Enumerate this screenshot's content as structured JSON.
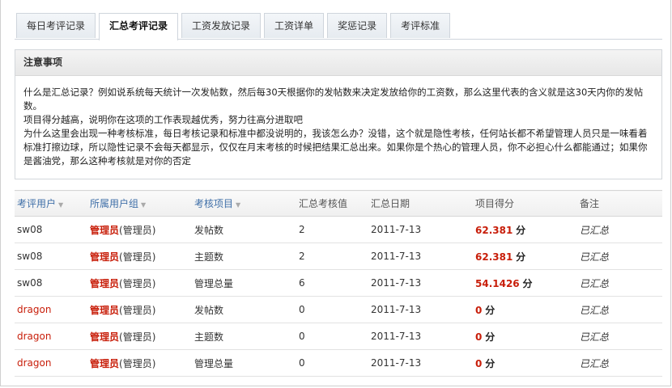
{
  "tabs": [
    {
      "label": "每日考评记录",
      "active": false
    },
    {
      "label": "汇总考评记录",
      "active": true
    },
    {
      "label": "工资发放记录",
      "active": false
    },
    {
      "label": "工资详单",
      "active": false
    },
    {
      "label": "奖惩记录",
      "active": false
    },
    {
      "label": "考评标准",
      "active": false
    }
  ],
  "notice": {
    "title": "注意事项",
    "lines": [
      "什么是汇总记录？例如说系统每天统计一次发帖数，然后每30天根据你的发帖数来决定发放给你的工资数，那么这里代表的含义就是这30天内你的发帖数。",
      "项目得分越高，说明你在这项的工作表现越优秀，努力往高分进取吧",
      "为什么这里会出现一种考核标准，每日考核记录和标准中都没说明的，我该怎么办？没错，这个就是隐性考核，任何站长都不希望管理人员只是一味看着标准打擦边球，所以隐性记录不会每天都显示，仅仅在月末考核的时候把结果汇总出来。如果你是个热心的管理人员，你不必担心什么都能通过；如果你是酱油党，那么这种考核就是对你的否定"
    ]
  },
  "table": {
    "headers": [
      "考评用户",
      "所属用户组",
      "考核项目",
      "汇总考核值",
      "汇总日期",
      "项目得分",
      "备注"
    ],
    "rows": [
      {
        "user": "sw08",
        "user_highlight": false,
        "group": "管理员",
        "group_paren": "(管理员)",
        "item": "发帖数",
        "value": "2",
        "date": "2011-7-13",
        "score": "62.381",
        "unit": "分",
        "remark": "已汇总"
      },
      {
        "user": "sw08",
        "user_highlight": false,
        "group": "管理员",
        "group_paren": "(管理员)",
        "item": "主题数",
        "value": "2",
        "date": "2011-7-13",
        "score": "62.381",
        "unit": "分",
        "remark": "已汇总"
      },
      {
        "user": "sw08",
        "user_highlight": false,
        "group": "管理员",
        "group_paren": "(管理员)",
        "item": "管理总量",
        "value": "6",
        "date": "2011-7-13",
        "score": "54.1426",
        "unit": "分",
        "remark": "已汇总"
      },
      {
        "user": "dragon",
        "user_highlight": true,
        "group": "管理员",
        "group_paren": "(管理员)",
        "item": "发帖数",
        "value": "0",
        "date": "2011-7-13",
        "score": "0",
        "unit": "分",
        "remark": "已汇总"
      },
      {
        "user": "dragon",
        "user_highlight": true,
        "group": "管理员",
        "group_paren": "(管理员)",
        "item": "主题数",
        "value": "0",
        "date": "2011-7-13",
        "score": "0",
        "unit": "分",
        "remark": "已汇总"
      },
      {
        "user": "dragon",
        "user_highlight": true,
        "group": "管理员",
        "group_paren": "(管理员)",
        "item": "管理总量",
        "value": "0",
        "date": "2011-7-13",
        "score": "0",
        "unit": "分",
        "remark": "已汇总"
      }
    ]
  }
}
